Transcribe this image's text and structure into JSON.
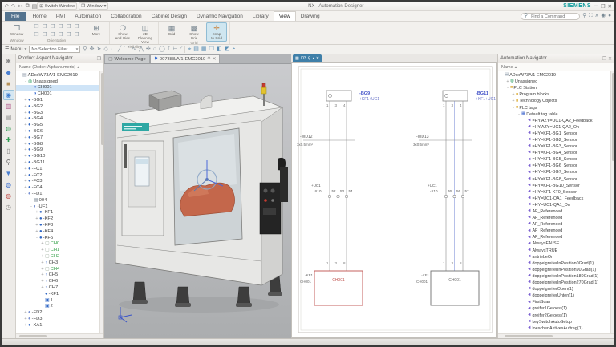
{
  "titlebar": {
    "title": "NX - Automation Designer",
    "brand": "SIEMENS",
    "quick_icons": [
      "undo-icon",
      "redo-icon",
      "cut-icon",
      "copy-icon",
      "paste-icon"
    ],
    "switch_window": "Switch Window",
    "window_menu": "Window"
  },
  "ribbon": {
    "file_tab": "File",
    "tabs": [
      "Home",
      "PMI",
      "Automation",
      "Collaboration",
      "Cabinet Design",
      "Dynamic Navigation",
      "Library",
      "View",
      "Drawing"
    ],
    "active_tab": "View",
    "search_placeholder": "Find a Command",
    "groups": [
      {
        "name": "Window",
        "buttons": [
          {
            "label": "Window",
            "icon": "window-icon",
            "big": true
          }
        ]
      },
      {
        "name": "Orientation",
        "grid": 12
      },
      {
        "name": "",
        "buttons": [
          {
            "label": "More",
            "icon": "more-windows-icon"
          }
        ]
      },
      {
        "name": "Visibility",
        "buttons": [
          {
            "label": "Show\nand Hide",
            "icon": "show-hide-icon"
          },
          {
            "label": "2D Planning\nView",
            "icon": "planning-view-icon"
          }
        ]
      },
      {
        "name": "Grid",
        "buttons": [
          {
            "label": "Grid",
            "icon": "grid-icon"
          },
          {
            "label": "Show\nGrid",
            "icon": "show-grid-icon"
          },
          {
            "label": "Snap\nto Grid",
            "icon": "snap-grid-icon",
            "active": true
          }
        ]
      }
    ]
  },
  "toolbar": {
    "menu_label": "Menu",
    "selection_filter": "No Selection Filter",
    "icons": [
      "zoom-icon",
      "pan-icon",
      "select-icon",
      "datum-icon",
      "point-icon",
      "line-icon",
      "arc-icon",
      "spline-icon",
      "polyline-icon",
      "move-icon",
      "circle-icon",
      "ellipse-icon",
      "trim-icon",
      "extend-icon",
      "fillet-icon",
      "measure-icon",
      "layers-icon",
      "view-style-icon",
      "window-icon",
      "render-icon",
      "tools-icon",
      "settings-icon"
    ]
  },
  "left_strip": [
    "gear-icon",
    "assembly-icon",
    "folder-icon",
    "visibility-icon",
    "roles-icon",
    "notes-icon",
    "parts-green-icon",
    "add-icon",
    "delete-icon",
    "search-icon",
    "filter-icon",
    "globe-blue-icon",
    "globe-red-icon",
    "history-icon"
  ],
  "left_panel": {
    "title": "Product Aspect Navigator",
    "float_icon": "float-panel-icon",
    "column_header": "Name (Order: Alphanumeric)",
    "tree": [
      {
        "d": 0,
        "e": "-",
        "i": "doc",
        "t": "ADxxW73A/1-EMC2019"
      },
      {
        "d": 1,
        "e": "-",
        "i": "glb",
        "t": "Unassigned"
      },
      {
        "d": 2,
        "e": "",
        "i": "ch",
        "t": "CH001",
        "sel": true
      },
      {
        "d": 2,
        "e": "",
        "i": "ch",
        "t": "CH001"
      },
      {
        "d": 1,
        "e": "+",
        "i": "dev",
        "t": "-BG1"
      },
      {
        "d": 1,
        "e": "+",
        "i": "dev",
        "t": "-BG2"
      },
      {
        "d": 1,
        "e": "+",
        "i": "dev",
        "t": "-BG3"
      },
      {
        "d": 1,
        "e": "+",
        "i": "dev",
        "t": "-BG4"
      },
      {
        "d": 1,
        "e": "+",
        "i": "dev",
        "t": "-BG5"
      },
      {
        "d": 1,
        "e": "+",
        "i": "dev",
        "t": "-BG6"
      },
      {
        "d": 1,
        "e": "+",
        "i": "dev",
        "t": "-BG7"
      },
      {
        "d": 1,
        "e": "+",
        "i": "dev",
        "t": "-BG8"
      },
      {
        "d": 1,
        "e": "+",
        "i": "dev",
        "t": "-BG9"
      },
      {
        "d": 1,
        "e": "+",
        "i": "dev",
        "t": "-BG10"
      },
      {
        "d": 1,
        "e": "+",
        "i": "dev",
        "t": "-BG11"
      },
      {
        "d": 1,
        "e": "+",
        "i": "dev",
        "t": "-FC1"
      },
      {
        "d": 1,
        "e": "+",
        "i": "dev",
        "t": "-FC2"
      },
      {
        "d": 1,
        "e": "+",
        "i": "dev",
        "t": "-FC3"
      },
      {
        "d": 1,
        "e": "+",
        "i": "dev",
        "t": "-FC4"
      },
      {
        "d": 1,
        "e": "-",
        "i": "mod",
        "t": "-FD1"
      },
      {
        "d": 2,
        "e": "",
        "i": "tbl",
        "t": "004"
      },
      {
        "d": 2,
        "e": "-",
        "i": "mod",
        "t": "-UF1"
      },
      {
        "d": 3,
        "e": "+",
        "i": "dev",
        "t": "-KF1"
      },
      {
        "d": 3,
        "e": "+",
        "i": "dev",
        "t": "-KF2"
      },
      {
        "d": 3,
        "e": "+",
        "i": "dev",
        "t": "-KF3"
      },
      {
        "d": 3,
        "e": "+",
        "i": "dev",
        "t": "-KF4"
      },
      {
        "d": 3,
        "e": "-",
        "i": "dev",
        "t": "-KF5"
      },
      {
        "d": 4,
        "e": "+",
        "i": "box",
        "t": "CH0",
        "c": "#2f9e44"
      },
      {
        "d": 4,
        "e": "+",
        "i": "box",
        "t": "CH1",
        "c": "#2f9e44"
      },
      {
        "d": 4,
        "e": "+",
        "i": "box",
        "t": "CH2",
        "c": "#2f9e44"
      },
      {
        "d": 4,
        "e": "+",
        "i": "ch",
        "t": "CH3"
      },
      {
        "d": 4,
        "e": "+",
        "i": "box",
        "t": "CH4",
        "c": "#2f9e44"
      },
      {
        "d": 4,
        "e": "+",
        "i": "ch",
        "t": "CH5"
      },
      {
        "d": 4,
        "e": "+",
        "i": "ch",
        "t": "CH6"
      },
      {
        "d": 4,
        "e": "+",
        "i": "ch",
        "t": "CH7"
      },
      {
        "d": 4,
        "e": "",
        "i": "dev",
        "t": "-KF1"
      },
      {
        "d": 4,
        "e": "",
        "i": "num",
        "t": "1"
      },
      {
        "d": 4,
        "e": "",
        "i": "num",
        "t": "2"
      },
      {
        "d": 1,
        "e": "+",
        "i": "mod",
        "t": "-FD2"
      },
      {
        "d": 1,
        "e": "+",
        "i": "mod",
        "t": "-FD3"
      },
      {
        "d": 1,
        "e": "+",
        "i": "dev",
        "t": "-XA1"
      }
    ]
  },
  "viewport": {
    "tabs": [
      {
        "label": "Welcome Page",
        "icon": "page-icon",
        "active": false
      },
      {
        "label": "007388/A/1-EMC2019",
        "icon": "flag-icon",
        "active": true,
        "pin_icon": "pin-icon",
        "close_icon": "close-icon"
      }
    ]
  },
  "schematic": {
    "tab_label": "/03",
    "circuits": [
      {
        "device": "-BG9",
        "location": "+KF1+UC1",
        "pins_top": [
          "1",
          "3",
          "4"
        ],
        "cable": "-WD12",
        "cable_spec": "3x0.5mm²",
        "terminal_location": "+UC1",
        "terminal_strip": "-X10",
        "terminals": [
          "52",
          "53",
          "54"
        ],
        "pins_bottom": [
          "1",
          "3",
          "8"
        ],
        "channel": "CH001",
        "channel_device": "-KF1",
        "channel_ref": "CH001",
        "selected": true
      },
      {
        "device": "-BG11",
        "location": "+KF1+UC1",
        "pins_top": [
          "1",
          "3",
          "4"
        ],
        "cable": "-WD13",
        "cable_spec": "3x0.5mm²",
        "terminal_location": "+UC1",
        "terminal_strip": "-X10",
        "terminals": [
          "55",
          "56",
          "57"
        ],
        "pins_bottom": [
          "1",
          "3",
          "8"
        ],
        "channel": "CH001",
        "channel_device": "-KF1",
        "channel_ref": "CH001",
        "selected": false
      }
    ]
  },
  "right_panel": {
    "title": "Automation Navigator",
    "close_icon": "close-icon",
    "column_header": "Name",
    "tree": [
      {
        "d": 0,
        "e": "-",
        "i": "doc",
        "t": "ADxxW73A/1-EMC2019"
      },
      {
        "d": 1,
        "e": "+",
        "i": "glb",
        "t": "Unassigned"
      },
      {
        "d": 1,
        "e": "-",
        "i": "fol",
        "t": "PLC Station"
      },
      {
        "d": 2,
        "e": "+",
        "i": "fol",
        "t": "Program blocks"
      },
      {
        "d": 2,
        "e": "+",
        "i": "fol",
        "t": "Technology Objects"
      },
      {
        "d": 2,
        "e": "-",
        "i": "fol",
        "t": "PLC tags"
      },
      {
        "d": 3,
        "e": "-",
        "i": "tbl2",
        "t": "Default tag table"
      },
      {
        "d": 4,
        "e": "",
        "i": "tag",
        "t": "=HY.AZY=UC1-QA2_Feedback"
      },
      {
        "d": 4,
        "e": "",
        "i": "tag",
        "t": "=HY.AZY=UC1-QA2_On"
      },
      {
        "d": 4,
        "e": "",
        "i": "tag",
        "t": "=HY=KF1-BG1_Sensor"
      },
      {
        "d": 4,
        "e": "",
        "i": "tag",
        "t": "=HY=KF1-BG2_Sensor"
      },
      {
        "d": 4,
        "e": "",
        "i": "tag",
        "t": "=HY=KF1-BG3_Sensor"
      },
      {
        "d": 4,
        "e": "",
        "i": "tag",
        "t": "=HY=KF1-BG4_Sensor"
      },
      {
        "d": 4,
        "e": "",
        "i": "tag",
        "t": "=HY=KF1-BG5_Sensor"
      },
      {
        "d": 4,
        "e": "",
        "i": "tag",
        "t": "=HY=KF1-BG6_Sensor"
      },
      {
        "d": 4,
        "e": "",
        "i": "tag",
        "t": "=HY=KF1-BG7_Sensor"
      },
      {
        "d": 4,
        "e": "",
        "i": "tag",
        "t": "=HY=KF1-BG8_Sensor"
      },
      {
        "d": 4,
        "e": "",
        "i": "tag",
        "t": "=HY=KF1-BG10_Sensor"
      },
      {
        "d": 4,
        "e": "",
        "i": "tag",
        "t": "=HY=KF1-KT0_Sensor"
      },
      {
        "d": 4,
        "e": "",
        "i": "tag",
        "t": "=HY=UC1-QA1_Feedback"
      },
      {
        "d": 4,
        "e": "",
        "i": "tag",
        "t": "=HY=UC1-QA1_On"
      },
      {
        "d": 4,
        "e": "",
        "i": "tag",
        "t": "AF_Referenced"
      },
      {
        "d": 4,
        "e": "",
        "i": "tag",
        "t": "AF_Referenced"
      },
      {
        "d": 4,
        "e": "",
        "i": "tag",
        "t": "AF_Referenced"
      },
      {
        "d": 4,
        "e": "",
        "i": "tag",
        "t": "AF_Referenced"
      },
      {
        "d": 4,
        "e": "",
        "i": "tag",
        "t": "AF_Referenced"
      },
      {
        "d": 4,
        "e": "",
        "i": "tag",
        "t": "AlwaysFALSE"
      },
      {
        "d": 4,
        "e": "",
        "i": "tag",
        "t": "AlwaysTRUE"
      },
      {
        "d": 4,
        "e": "",
        "i": "tag",
        "t": "antriebeOn"
      },
      {
        "d": 4,
        "e": "",
        "i": "tag",
        "t": "doppelgreiferInPosition0Grad(1)"
      },
      {
        "d": 4,
        "e": "",
        "i": "tag",
        "t": "doppelgreiferInPosition90Grad(1)"
      },
      {
        "d": 4,
        "e": "",
        "i": "tag",
        "t": "doppelgreiferInPosition180Grad(1)"
      },
      {
        "d": 4,
        "e": "",
        "i": "tag",
        "t": "doppelgreiferInPosition270Grad(1)"
      },
      {
        "d": 4,
        "e": "",
        "i": "tag",
        "t": "doppelgreiferOben(1)"
      },
      {
        "d": 4,
        "e": "",
        "i": "tag",
        "t": "doppelgreiferUnten(1)"
      },
      {
        "d": 4,
        "e": "",
        "i": "tag",
        "t": "FirstScan"
      },
      {
        "d": 4,
        "e": "",
        "i": "tag",
        "t": "greifer1Geloest(1)"
      },
      {
        "d": 4,
        "e": "",
        "i": "tag",
        "t": "greifer2Geloest(1)"
      },
      {
        "d": 4,
        "e": "",
        "i": "tag",
        "t": "keySwitchAutoSetup"
      },
      {
        "d": 4,
        "e": "",
        "i": "tag",
        "t": "loeschenAktivesAuftrag(1)"
      }
    ]
  },
  "colors": {
    "accent_teal": "#0f9b9b",
    "selection_blue": "#cfe4f7",
    "wire_blue": "#97a6e0",
    "selected_red": "#c0524e",
    "machine_orange": "#c4674b"
  }
}
